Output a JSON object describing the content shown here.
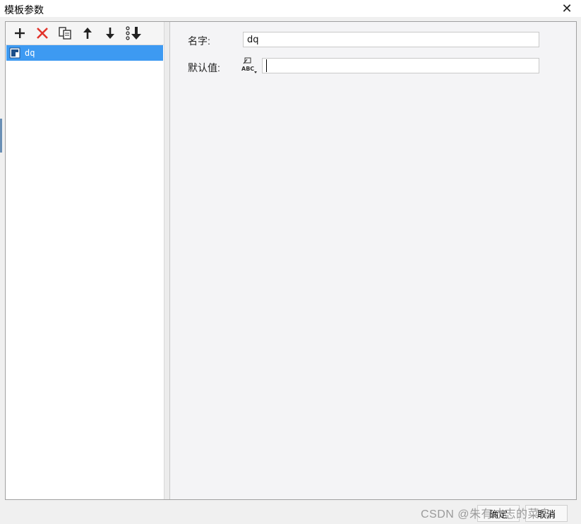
{
  "window": {
    "title": "模板参数",
    "close_glyph": "✕"
  },
  "toolbar": {
    "buttons": [
      {
        "name": "add-icon",
        "color": "#222222"
      },
      {
        "name": "delete-icon",
        "color": "#e2342c"
      },
      {
        "name": "copy-icon",
        "color": "#333333"
      },
      {
        "name": "move-up-icon",
        "color": "#222222"
      },
      {
        "name": "move-down-icon",
        "color": "#222222"
      },
      {
        "name": "move-bottom-icon",
        "color": "#222222"
      }
    ]
  },
  "tree": {
    "items": [
      {
        "label": "dq",
        "selected": true,
        "icon": "parameter-icon"
      }
    ],
    "selection_color": "#3d9af2"
  },
  "form": {
    "name_label": "名字:",
    "name_value": "dq",
    "default_label": "默认值:",
    "default_value": "",
    "default_type_icon": "abc-type-icon"
  },
  "footer": {
    "ok_label": "确定",
    "cancel_label": "取消"
  },
  "watermark": "CSDN @朱有才志的菜鸟"
}
